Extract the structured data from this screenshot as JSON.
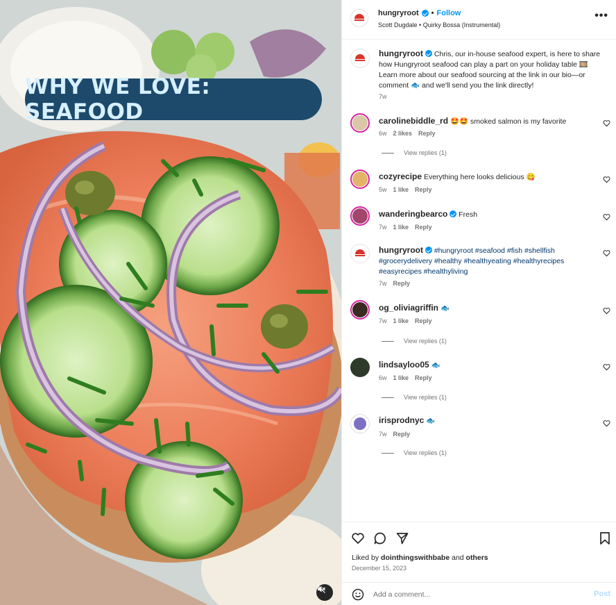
{
  "media": {
    "overlay_title": "WHY WE LOVE: SEAFOOD",
    "mute_icon": "speaker-muted-icon"
  },
  "header": {
    "username": "hungryroot",
    "separator": "•",
    "follow_label": "Follow",
    "audio": "Scott Dugdale • Quirky Bossa (Instrumental)",
    "more_icon": "more-options-icon",
    "more_label": "•••"
  },
  "caption": {
    "username": "hungryroot",
    "text": "Chris, our in-house seafood expert, is here to share how Hungryroot seafood can play a part on your holiday table 🎞️ Learn more about our seafood sourcing at the link in our bio—or comment 🐟 and we'll send you the link directly!",
    "time": "7w"
  },
  "comments": [
    {
      "username": "carolinebiddle_rd",
      "text": "🤩🤩 smoked salmon is my favorite",
      "time": "6w",
      "likes": "2 likes",
      "reply": "Reply",
      "view_replies": "View replies (1)",
      "avatar_color": "#d9c7a8"
    },
    {
      "username": "cozyrecipe",
      "text": "Everything here looks delicious 😋",
      "time": "5w",
      "likes": "1 like",
      "reply": "Reply",
      "avatar_color": "#e4b36a"
    },
    {
      "username": "wanderingbearco",
      "text": "Fresh",
      "time": "7w",
      "likes": "1 like",
      "reply": "Reply",
      "avatar_color": "#a2466e"
    },
    {
      "username": "hungryroot",
      "hashtags": "#hungryroot #seafood #fish #shellfish #grocerydelivery #healthy #healthyeating #healthyrecipes #easyrecipes #healthyliving",
      "time": "7w",
      "reply": "Reply"
    },
    {
      "username": "og_oliviagriffin",
      "text": "🐟",
      "time": "7w",
      "likes": "1 like",
      "reply": "Reply",
      "view_replies": "View replies (1)",
      "avatar_color": "#3a2a22"
    },
    {
      "username": "lindsayloo05",
      "text": "🐟",
      "time": "6w",
      "likes": "1 like",
      "reply": "Reply",
      "view_replies": "View replies (1)",
      "avatar_color": "#2e3a2a"
    },
    {
      "username": "irisprodnyc",
      "text": "🐟",
      "time": "7w",
      "reply": "Reply",
      "view_replies": "View replies (1)",
      "avatar_color": "#7d6fc4"
    }
  ],
  "footer": {
    "liked_by_prefix": "Liked by ",
    "liked_by_user": "dointhingswithbabe",
    "liked_by_suffix": " and ",
    "liked_by_others": "others",
    "date": "December 15, 2023",
    "comment_placeholder": "Add a comment...",
    "post_label": "Post"
  },
  "colors": {
    "accent": "#0095f6",
    "brand_red": "#d8332a",
    "overlay_bg": "#1d4a6b"
  }
}
